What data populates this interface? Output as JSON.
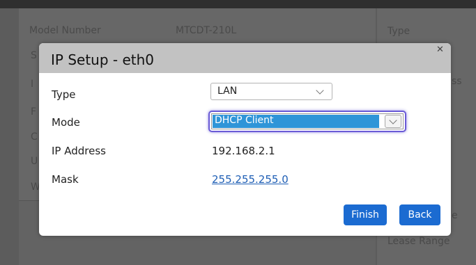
{
  "background": {
    "left_rows": [
      {
        "label": "Model Number",
        "value": "MTCDT-210L"
      },
      {
        "label": "S"
      },
      {
        "label": "I"
      },
      {
        "label": "F"
      },
      {
        "label": "C"
      },
      {
        "label": "U"
      },
      {
        "label": "W"
      }
    ],
    "right_rows": [
      "Type",
      "ss",
      "e",
      "Lease Range"
    ]
  },
  "modal": {
    "title": "IP Setup - eth0",
    "close_icon": "close-icon",
    "fields": {
      "type_label": "Type",
      "type_value": "LAN",
      "mode_label": "Mode",
      "mode_value": "DHCP Client",
      "ip_label": "IP Address",
      "ip_value": "192.168.2.1",
      "mask_label": "Mask",
      "mask_value": "255.255.255.0"
    },
    "buttons": {
      "finish": "Finish",
      "back": "Back"
    }
  },
  "colors": {
    "button": "#1b6bd1",
    "selection": "#2f95d8",
    "focus_ring": "#6a5bd6",
    "link": "#1f5fb5"
  }
}
